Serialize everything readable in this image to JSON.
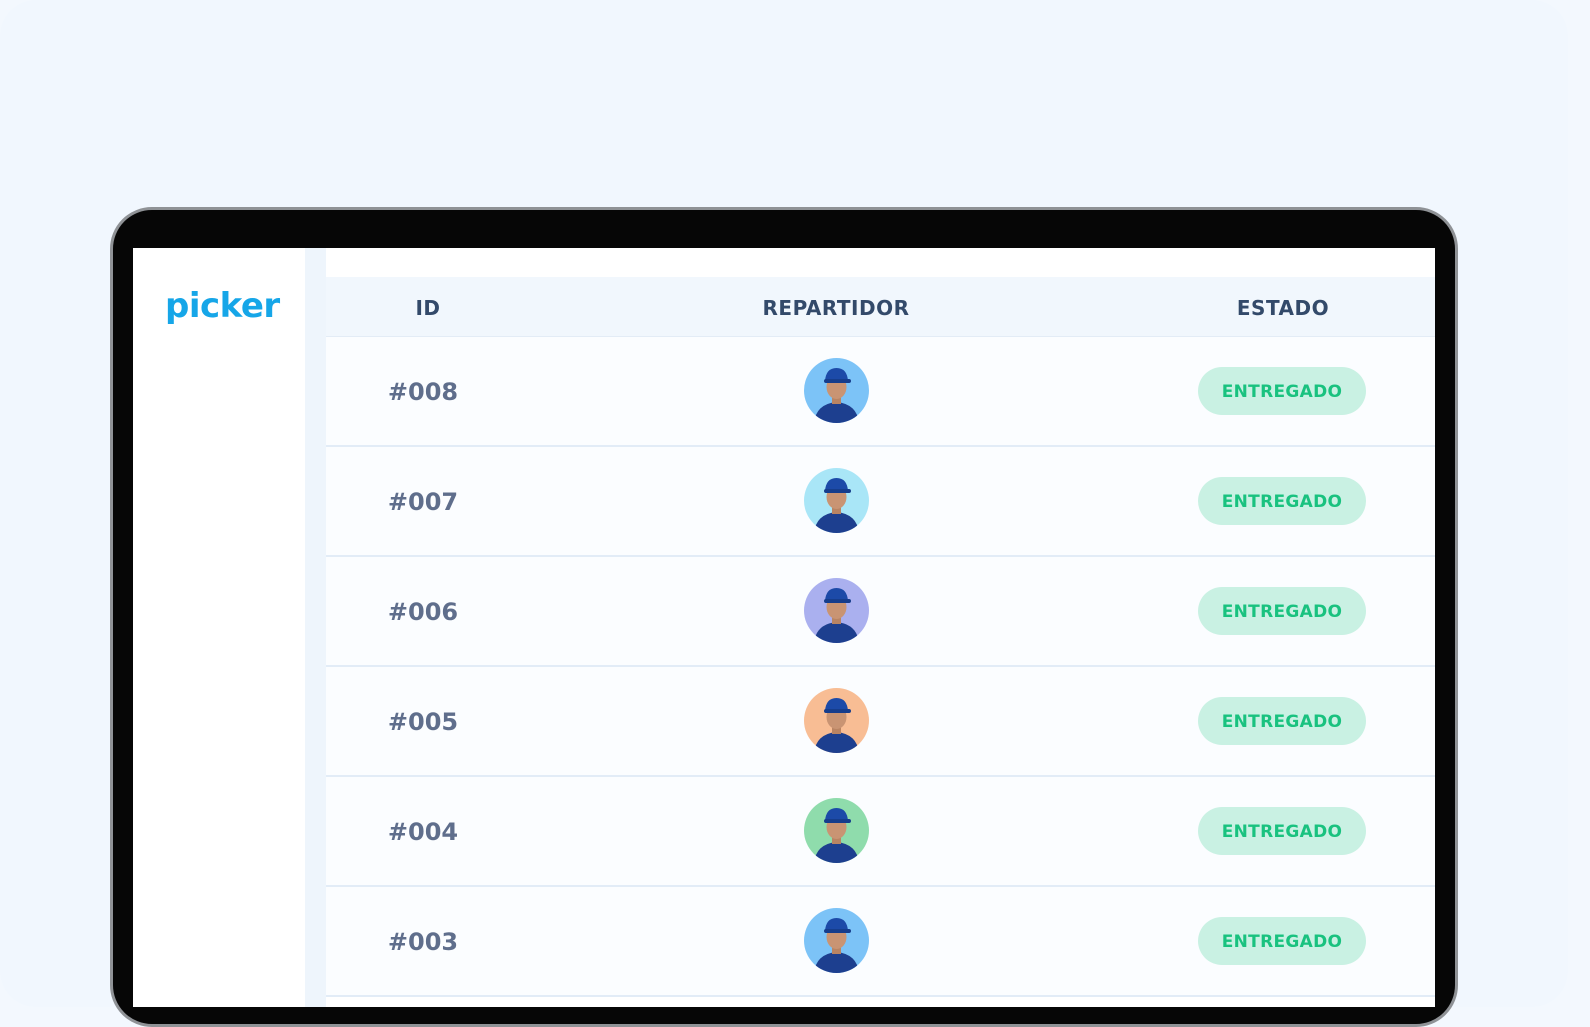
{
  "app": {
    "logo": "picker"
  },
  "table": {
    "headers": {
      "id": "ID",
      "courier": "REPARTIDOR",
      "status": "ESTADO"
    },
    "rows": [
      {
        "id": "#008",
        "status": "ENTREGADO",
        "avatar_bg": "#7cc3f7"
      },
      {
        "id": "#007",
        "status": "ENTREGADO",
        "avatar_bg": "#a9e6f7"
      },
      {
        "id": "#006",
        "status": "ENTREGADO",
        "avatar_bg": "#aab0ef"
      },
      {
        "id": "#005",
        "status": "ENTREGADO",
        "avatar_bg": "#f8bd94"
      },
      {
        "id": "#004",
        "status": "ENTREGADO",
        "avatar_bg": "#8fdcac"
      },
      {
        "id": "#003",
        "status": "ENTREGADO",
        "avatar_bg": "#7cc3f7"
      }
    ]
  },
  "colors": {
    "brand": "#16a6e8",
    "badge_bg": "#c9f1e3",
    "badge_text": "#19c27f"
  },
  "icons": {
    "courier_avatar": "person-avatar-icon"
  }
}
